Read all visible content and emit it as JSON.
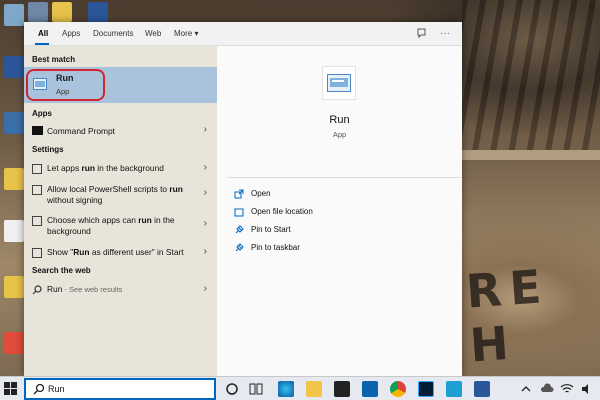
{
  "tabs": [
    {
      "label": "All"
    },
    {
      "label": "Apps"
    },
    {
      "label": "Documents"
    },
    {
      "label": "Web"
    },
    {
      "label": "More ▾"
    }
  ],
  "header_icons": {
    "feedback": "feedback-icon",
    "more": "···"
  },
  "sections": {
    "best_match": "Best match",
    "apps": "Apps",
    "settings": "Settings",
    "search_web": "Search the web"
  },
  "best_match": {
    "title": "Run",
    "subtitle": "App"
  },
  "apps": [
    {
      "label": "Command Prompt"
    }
  ],
  "settings": [
    {
      "pre": "Let apps ",
      "bold": "run",
      "post": " in the background"
    },
    {
      "pre": "Allow local PowerShell scripts to ",
      "bold": "run",
      "post": " without signing"
    },
    {
      "pre": "Choose which apps can ",
      "bold": "run",
      "post": " in the background"
    },
    {
      "pre": "Show \"",
      "bold": "Run",
      "post": " as different user\" in Start"
    }
  ],
  "web": {
    "bold": "Run",
    "rest": " - See web results"
  },
  "preview": {
    "title": "Run",
    "subtitle": "App"
  },
  "actions": [
    {
      "label": "Open"
    },
    {
      "label": "Open file location"
    },
    {
      "label": "Pin to Start"
    },
    {
      "label": "Pin to taskbar"
    }
  ],
  "search": {
    "value": "Run"
  },
  "colors": {
    "accent": "#0067c0",
    "selection": "#aac3dd",
    "highlight_ring": "#d0262b"
  },
  "background": {
    "graffiti": "RE H"
  }
}
